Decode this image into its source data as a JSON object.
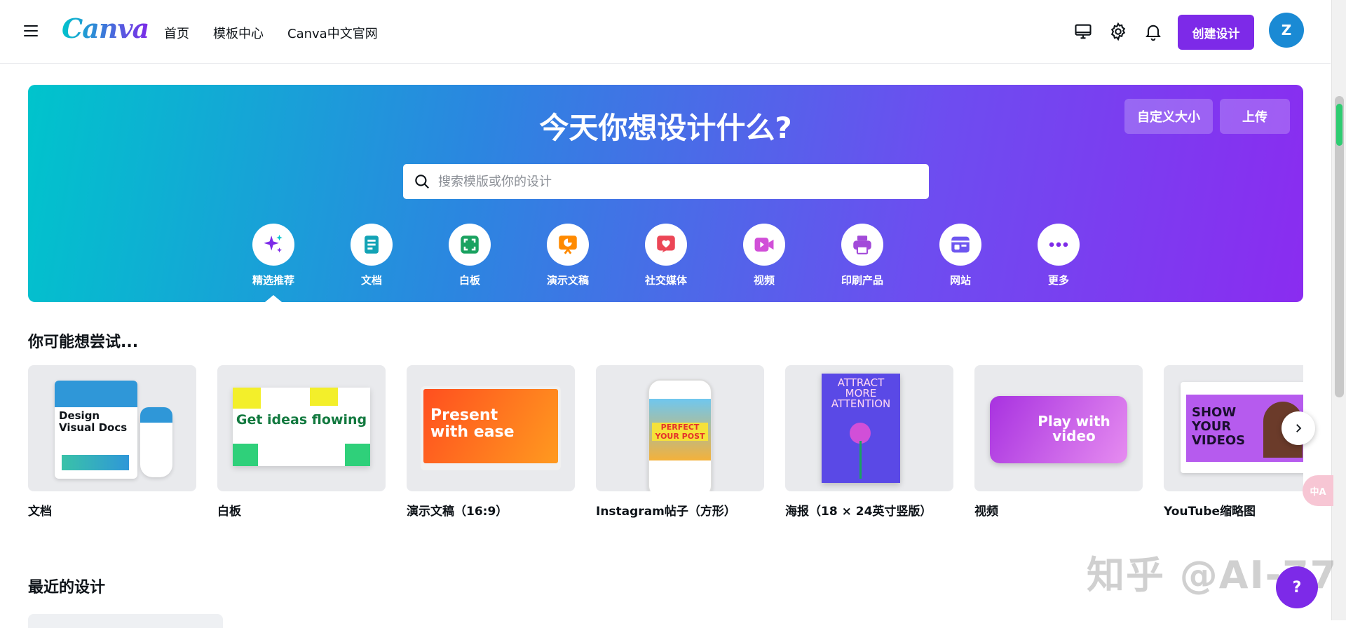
{
  "header": {
    "logo": "Canva",
    "nav": [
      "首页",
      "模板中心",
      "Canva中文官网"
    ],
    "create_label": "创建设计",
    "avatar_initial": "Z"
  },
  "hero": {
    "title": "今天你想设计什么?",
    "custom_size_label": "自定义大小",
    "upload_label": "上传",
    "search_placeholder": "搜索模版或你的设计",
    "categories": [
      {
        "label": "精选推荐",
        "icon": "sparkle-icon",
        "color": "#7d2ae8"
      },
      {
        "label": "文档",
        "icon": "doc-icon",
        "color": "#13a3b5"
      },
      {
        "label": "白板",
        "icon": "whiteboard-icon",
        "color": "#1aa260"
      },
      {
        "label": "演示文稿",
        "icon": "presentation-icon",
        "color": "#ff8a00"
      },
      {
        "label": "社交媒体",
        "icon": "heart-icon",
        "color": "#ec4656"
      },
      {
        "label": "视频",
        "icon": "video-icon",
        "color": "#d14fd8"
      },
      {
        "label": "印刷产品",
        "icon": "printer-icon",
        "color": "#a24ad9"
      },
      {
        "label": "网站",
        "icon": "website-icon",
        "color": "#6e56f0"
      },
      {
        "label": "更多",
        "icon": "more-icon",
        "color": "#7d2ae8"
      }
    ]
  },
  "suggestions": {
    "title": "你可能想尝试...",
    "items": [
      {
        "label": "文档",
        "art_text": "Design Visual Docs"
      },
      {
        "label": "白板",
        "art_text": "Get ideas flowing"
      },
      {
        "label": "演示文稿（16:9）",
        "art_text": "Present with ease"
      },
      {
        "label": "Instagram帖子（方形）",
        "art_text": "PERFECT YOUR POST"
      },
      {
        "label": "海报（18 × 24英寸竖版）",
        "art_text": "ATTRACT MORE ATTENTION"
      },
      {
        "label": "视频",
        "art_text": "Play with video"
      },
      {
        "label": "YouTube缩略图",
        "art_text": "SHOW YOUR VIDEOS"
      }
    ]
  },
  "recent": {
    "title": "最近的设计"
  },
  "help_label": "?",
  "watermark": "知乎 @AI-77",
  "translate_label": "中A"
}
